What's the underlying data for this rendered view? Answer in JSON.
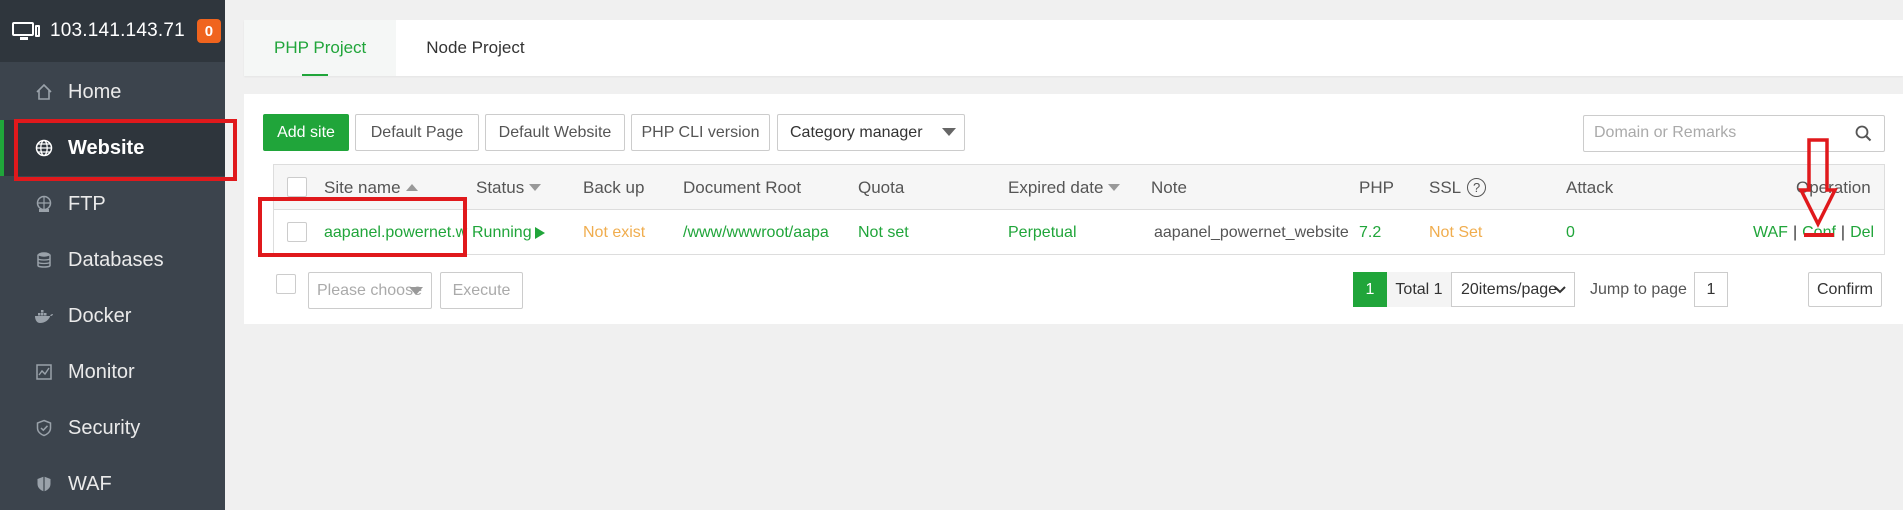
{
  "sidebar": {
    "server_ip": "103.141.143.71",
    "badge": "0",
    "items": [
      {
        "label": "Home",
        "icon": "home-icon"
      },
      {
        "label": "Website",
        "icon": "globe-icon",
        "active": true
      },
      {
        "label": "FTP",
        "icon": "ftp-icon"
      },
      {
        "label": "Databases",
        "icon": "database-icon"
      },
      {
        "label": "Docker",
        "icon": "docker-icon"
      },
      {
        "label": "Monitor",
        "icon": "monitor-chart-icon"
      },
      {
        "label": "Security",
        "icon": "shield-icon"
      },
      {
        "label": "WAF",
        "icon": "waf-shield-icon"
      }
    ]
  },
  "tabs": [
    {
      "label": "PHP Project",
      "active": true
    },
    {
      "label": "Node Project"
    }
  ],
  "toolbar": {
    "add_site": "Add site",
    "default_page": "Default Page",
    "default_website": "Default Website",
    "php_cli": "PHP CLI version",
    "category_manager": "Category manager",
    "search_placeholder": "Domain or Remarks"
  },
  "table": {
    "headers": {
      "site_name": "Site name",
      "status": "Status",
      "backup": "Back up",
      "doc_root": "Document Root",
      "quota": "Quota",
      "expired": "Expired date",
      "note": "Note",
      "php": "PHP",
      "ssl": "SSL",
      "attack": "Attack",
      "operation": "Operation"
    },
    "rows": [
      {
        "site_name": "aapanel.powernet.w",
        "status": "Running",
        "backup": "Not exist",
        "doc_root": "/www/wwwroot/aapa",
        "quota": "Not set",
        "expired": "Perpetual",
        "note": "aapanel_powernet_website",
        "php": "7.2",
        "ssl": "Not Set",
        "attack": "0",
        "ops": {
          "waf": "WAF",
          "conf": "Conf",
          "del": "Del",
          "sep": "|"
        }
      }
    ]
  },
  "footer": {
    "batch_placeholder": "Please choose",
    "execute": "Execute",
    "page": "1",
    "total": "Total 1",
    "page_size": "20items/page",
    "jump_label": "Jump to page",
    "jump_value": "1",
    "confirm": "Confirm"
  },
  "colors": {
    "accent": "#20a53a",
    "warning": "#f0ad4e",
    "annotation": "#e0191c",
    "sidebar_bg": "#3c444d"
  }
}
